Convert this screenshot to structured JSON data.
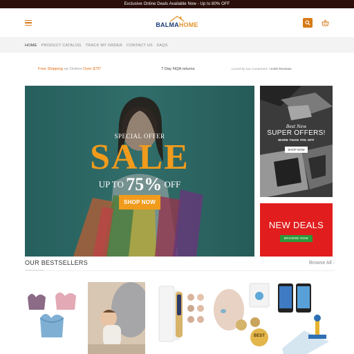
{
  "topbar": {
    "text": "Exclusive Online Deals Available Now - Up to 80% OFF"
  },
  "header": {
    "logo": {
      "part1": "BALMA",
      "part2": "HOME"
    },
    "icons": {
      "menu": "hamburger-icon",
      "search": "search-icon",
      "cart": "basket-icon"
    }
  },
  "nav": {
    "items": [
      "HOME",
      "PRODUCT CATALOG",
      "TRACK MY ORDER",
      "CONTACT US",
      "FAQS"
    ],
    "active_index": 0
  },
  "features": {
    "shipping_prefix": "Free Shipping",
    "shipping_mid": "on Orders",
    "shipping_suffix": "Over $75*",
    "returns": "7 Day NQA returns",
    "loved_prefix": "Loved by our Customers",
    "loved_count": "+1000 Reviews"
  },
  "hero": {
    "special": "SPECIAL OFFER",
    "sale": "SALE",
    "upto": "UP TO",
    "percent": "75%",
    "off": "OFF",
    "cta": "SHOP NOW"
  },
  "side_promo": {
    "best": "Best New",
    "super": "SUPER OFFERS!",
    "more": "MORE THAN 70% OFF",
    "cta": "SHOP NOW"
  },
  "deals_promo": {
    "title": "NEW DEALS",
    "cta": "BROWSE NOW"
  },
  "bestsellers": {
    "title": "OUR BESTSELLERS",
    "browse": "Browse All",
    "products": [
      {
        "name": "bras-product-image"
      },
      {
        "name": "baby-pillow-product-image"
      },
      {
        "name": "mole-pen-product-image"
      },
      {
        "name": "anti-snore-product-image"
      },
      {
        "name": "screen-repair-product-image"
      }
    ]
  },
  "colors": {
    "accent": "#d77a18",
    "topbar": "#2a0f0a",
    "sale": "#f19b1c",
    "deals_bg": "#e11d1d",
    "deals_btn": "#2a9a3a"
  }
}
